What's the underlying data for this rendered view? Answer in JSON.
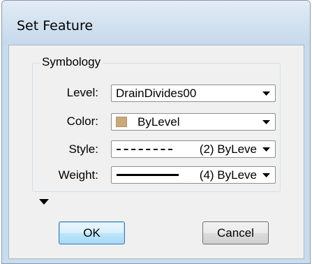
{
  "window": {
    "title": "Set Feature"
  },
  "symbology": {
    "group_label": "Symbology",
    "level": {
      "label": "Level:",
      "value": "DrainDivides00"
    },
    "color": {
      "label": "Color:",
      "value": "ByLevel",
      "swatch_color": "#c8a97a"
    },
    "style": {
      "label": "Style:",
      "value": "(2) ByLeve"
    },
    "weight": {
      "label": "Weight:",
      "value": "(4) ByLeve"
    }
  },
  "buttons": {
    "ok": "OK",
    "cancel": "Cancel"
  },
  "colors": {
    "titlebar": "#c9dced",
    "dialog_bg": "#f0f0f0",
    "default_button_border": "#3c7fb1"
  }
}
